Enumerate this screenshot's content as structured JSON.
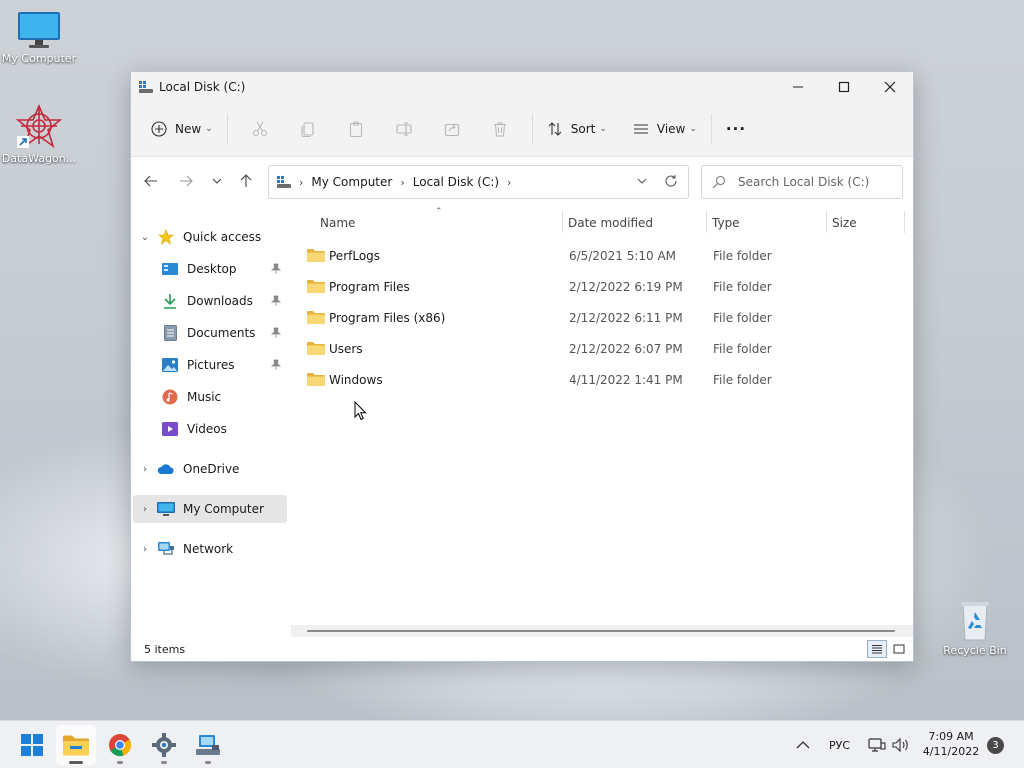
{
  "desktop": {
    "icons": [
      {
        "label": "My Computer",
        "icon": "monitor-icon"
      },
      {
        "label": "DataWagon...",
        "icon": "datawagon-shortcut-icon"
      },
      {
        "label": "Recycle Bin",
        "icon": "recycle-bin-icon"
      }
    ]
  },
  "window": {
    "title": "Local Disk (C:)",
    "commandbar": {
      "new_label": "New",
      "sort_label": "Sort",
      "view_label": "View",
      "more_label": "···"
    },
    "address": {
      "crumbs": [
        "My Computer",
        "Local Disk (C:)"
      ]
    },
    "search": {
      "placeholder": "Search Local Disk (C:)"
    },
    "nav": {
      "quick_access": "Quick access",
      "pinned": [
        {
          "label": "Desktop",
          "icon": "desktop-icon",
          "pinned": true
        },
        {
          "label": "Downloads",
          "icon": "download-icon",
          "pinned": true
        },
        {
          "label": "Documents",
          "icon": "documents-icon",
          "pinned": true
        },
        {
          "label": "Pictures",
          "icon": "pictures-icon",
          "pinned": true
        },
        {
          "label": "Music",
          "icon": "music-icon",
          "pinned": false
        },
        {
          "label": "Videos",
          "icon": "videos-icon",
          "pinned": false
        }
      ],
      "onedrive": "OneDrive",
      "my_computer": "My Computer",
      "network": "Network"
    },
    "columns": {
      "name": "Name",
      "date": "Date modified",
      "type": "Type",
      "size": "Size"
    },
    "files": [
      {
        "name": "PerfLogs",
        "date": "6/5/2021 5:10 AM",
        "type": "File folder"
      },
      {
        "name": "Program Files",
        "date": "2/12/2022 6:19 PM",
        "type": "File folder"
      },
      {
        "name": "Program Files (x86)",
        "date": "2/12/2022 6:11 PM",
        "type": "File folder"
      },
      {
        "name": "Users",
        "date": "2/12/2022 6:07 PM",
        "type": "File folder"
      },
      {
        "name": "Windows",
        "date": "4/11/2022 1:41 PM",
        "type": "File folder"
      }
    ],
    "status": "5 items"
  },
  "taskbar": {
    "language": "РУС",
    "time": "7:09 AM",
    "date": "4/11/2022",
    "notifications": "3"
  },
  "colors": {
    "accent": "#0067c0",
    "folder": "#f8d775",
    "selected": "#e5e5e5"
  }
}
